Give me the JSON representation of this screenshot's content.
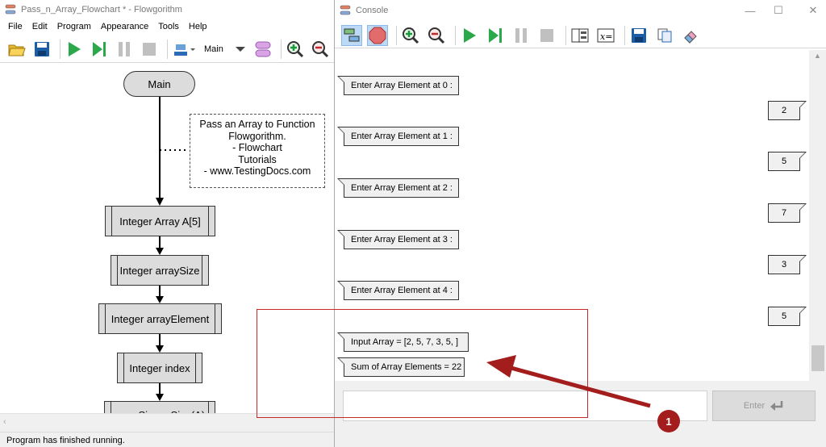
{
  "main_window": {
    "title": "Pass_n_Array_Flowchart * - Flowgorithm",
    "menu": [
      "File",
      "Edit",
      "Program",
      "Appearance",
      "Tools",
      "Help"
    ],
    "function_select": "Main",
    "status": "Program has finished running."
  },
  "flowchart": {
    "start": "Main",
    "comment_lines": [
      "Pass an Array to Function",
      "Flowgorithm.",
      "- Flowchart",
      "Tutorials",
      "- www.TestingDocs.com"
    ],
    "declares": [
      "Integer Array A[5]",
      "Integer arraySize",
      "Integer arrayElement",
      "Integer index"
    ],
    "assign": "arraySize = Size(A)"
  },
  "console_window": {
    "title": "Console",
    "prompts": [
      "Enter Array Element at 0 :",
      "Enter Array Element at 1 :",
      "Enter Array Element at 2 :",
      "Enter Array Element at 3 :",
      "Enter Array Element at 4 :"
    ],
    "inputs": [
      "2",
      "5",
      "7",
      "3",
      "5"
    ],
    "output_array": "Input Array = [2, 5, 7, 3, 5,  ]",
    "output_sum": "Sum of Array Elements = 22",
    "input_value": "",
    "enter_label": "Enter"
  },
  "annotation": {
    "badge": "1",
    "color": "#a31d1d"
  }
}
